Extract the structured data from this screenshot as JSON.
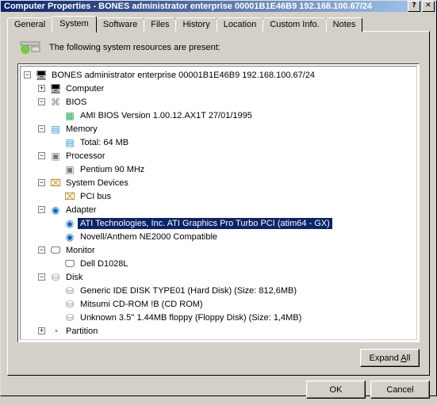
{
  "window": {
    "title": "Computer Properties - BONES administrator enterprise 00001B1E46B9 192.168.100.67/24"
  },
  "tabs": [
    {
      "label": "General"
    },
    {
      "label": "System"
    },
    {
      "label": "Software"
    },
    {
      "label": "Files"
    },
    {
      "label": "History"
    },
    {
      "label": "Location"
    },
    {
      "label": "Custom Info."
    },
    {
      "label": "Notes"
    }
  ],
  "panel": {
    "intro": "The following system resources are present:"
  },
  "tree": {
    "root": "BONES administrator enterprise 00001B1E46B9 192.168.100.67/24",
    "computer": "Computer",
    "bios": "BIOS",
    "bios_ver": "AMI BIOS Version 1.00.12.AX1T 27/01/1995",
    "memory": "Memory",
    "memory_total": "Total: 64 MB",
    "processor": "Processor",
    "processor_val": "Pentium 90 MHz",
    "sysdev": "System Devices",
    "sysdev_pci": "PCI bus",
    "adapter": "Adapter",
    "adapter_ati": "ATI Technologies, Inc. ATI Graphics Pro Turbo PCI (atim64 - GX)",
    "adapter_ne2000": "Novell/Anthem NE2000 Compatible",
    "monitor": "Monitor",
    "monitor_val": "Dell D1028L",
    "disk": "Disk",
    "disk_generic": "Generic IDE  DISK TYPE01 (Hard Disk) (Size: 812,6MB)",
    "disk_cdrom": "Mitsumi CD-ROM       !B (CD ROM)",
    "disk_floppy": "Unknown 3.5'' 1.44MB floppy (Floppy Disk) (Size: 1,4MB)",
    "partition": "Partition"
  },
  "buttons": {
    "expand_all_pre": "Expand ",
    "expand_all_u": "A",
    "expand_all_post": "ll",
    "ok": "OK",
    "cancel": "Cancel"
  }
}
